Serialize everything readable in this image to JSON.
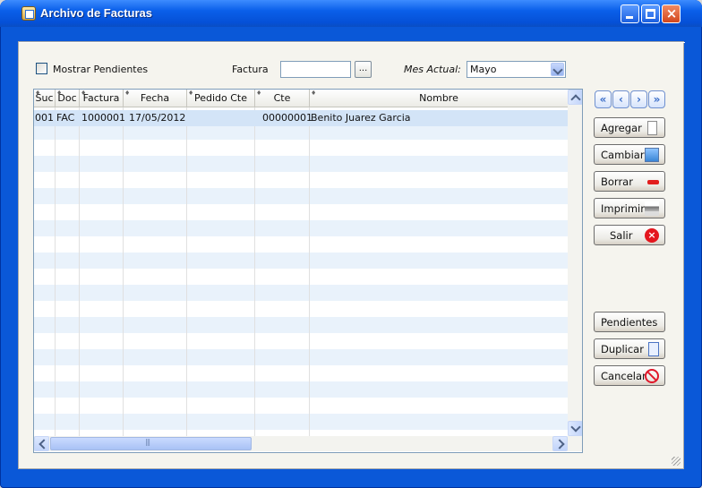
{
  "window": {
    "title": "Archivo de Facturas"
  },
  "filters": {
    "pending_label": "Mostrar Pendientes",
    "pending_checked": false,
    "invoice_label": "Factura",
    "invoice_value": "",
    "ellipsis_label": "...",
    "month_label": "Mes Actual:",
    "month_value": "Mayo"
  },
  "grid": {
    "columns": [
      "Suc",
      "Doc",
      "Factura",
      "Fecha",
      "Pedido Cte",
      "Cte",
      "Nombre"
    ],
    "rows": [
      {
        "suc": "001",
        "doc": "FAC",
        "factura": "1000001",
        "fecha": "17/05/2012",
        "pedido": "",
        "cte": "00000001",
        "nombre": "Benito Juarez Garcia"
      }
    ]
  },
  "nav": {
    "first": "«",
    "prev": "‹",
    "next": "›",
    "last": "»"
  },
  "actions": {
    "agregar": "Agregar",
    "cambiar": "Cambiar",
    "borrar": "Borrar",
    "imprimir": "Imprimir",
    "salir": "Salir",
    "pendientes": "Pendientes",
    "duplicar": "Duplicar",
    "cancelar": "Cancelar"
  },
  "icons": {
    "close": "×"
  }
}
